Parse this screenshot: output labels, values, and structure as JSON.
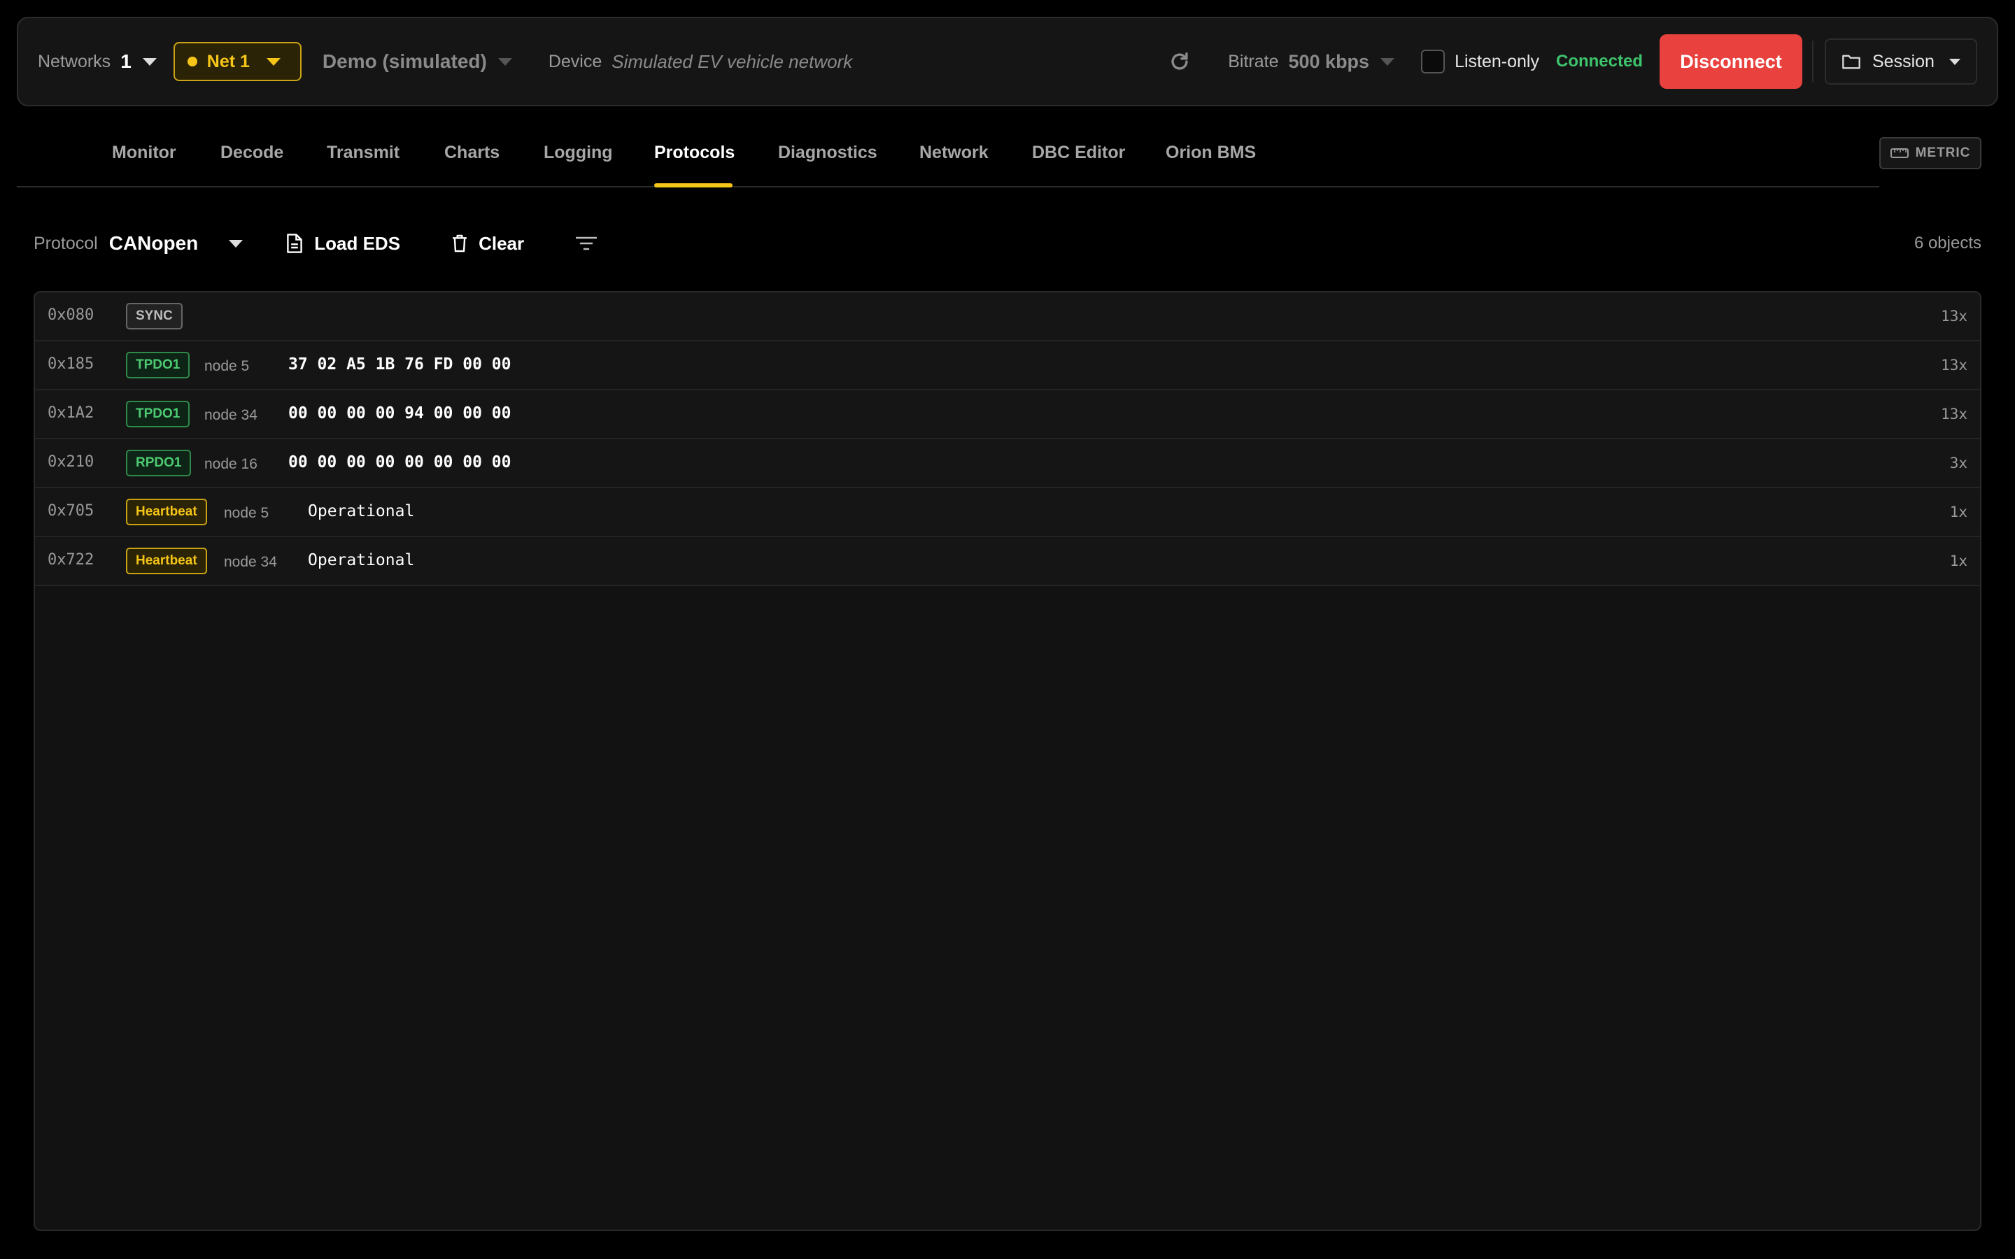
{
  "topbar": {
    "networks_label": "Networks",
    "networks_count": "1",
    "net_pill": "Net 1",
    "demo_label": "Demo (simulated)",
    "device_label": "Device",
    "device_value": "Simulated EV vehicle network",
    "bitrate_label": "Bitrate",
    "bitrate_value": "500 kbps",
    "listen_only_label": "Listen-only",
    "listen_only_checked": false,
    "status": "Connected",
    "disconnect_label": "Disconnect",
    "session_label": "Session"
  },
  "tabs": [
    {
      "label": "Monitor",
      "active": false
    },
    {
      "label": "Decode",
      "active": false
    },
    {
      "label": "Transmit",
      "active": false
    },
    {
      "label": "Charts",
      "active": false
    },
    {
      "label": "Logging",
      "active": false
    },
    {
      "label": "Protocols",
      "active": true
    },
    {
      "label": "Diagnostics",
      "active": false
    },
    {
      "label": "Network",
      "active": false
    },
    {
      "label": "DBC Editor",
      "active": false
    },
    {
      "label": "Orion BMS",
      "active": false
    }
  ],
  "units_toggle": "METRIC",
  "toolbar": {
    "protocol_label": "Protocol",
    "protocol_value": "CANopen",
    "load_eds_label": "Load EDS",
    "clear_label": "Clear",
    "object_count": "6 objects"
  },
  "objects": [
    {
      "cob_id": "0x080",
      "type": "SYNC",
      "node": "",
      "payload": "",
      "count": "13x"
    },
    {
      "cob_id": "0x185",
      "type": "TPDO1",
      "node": "node 5",
      "payload": "37 02 A5 1B 76 FD 00 00",
      "count": "13x"
    },
    {
      "cob_id": "0x1A2",
      "type": "TPDO1",
      "node": "node 34",
      "payload": "00 00 00 00 94 00 00 00",
      "count": "13x"
    },
    {
      "cob_id": "0x210",
      "type": "RPDO1",
      "node": "node 16",
      "payload": "00 00 00 00 00 00 00 00",
      "count": "3x"
    },
    {
      "cob_id": "0x705",
      "type": "Heartbeat",
      "node": "node 5",
      "payload": "Operational",
      "count": "1x"
    },
    {
      "cob_id": "0x722",
      "type": "Heartbeat",
      "node": "node 34",
      "payload": "Operational",
      "count": "1x"
    }
  ],
  "colors": {
    "accent": "#f5c518",
    "connected": "#3ec46d",
    "disconnect": "#e8413e",
    "pdo": "#4ccb72"
  }
}
